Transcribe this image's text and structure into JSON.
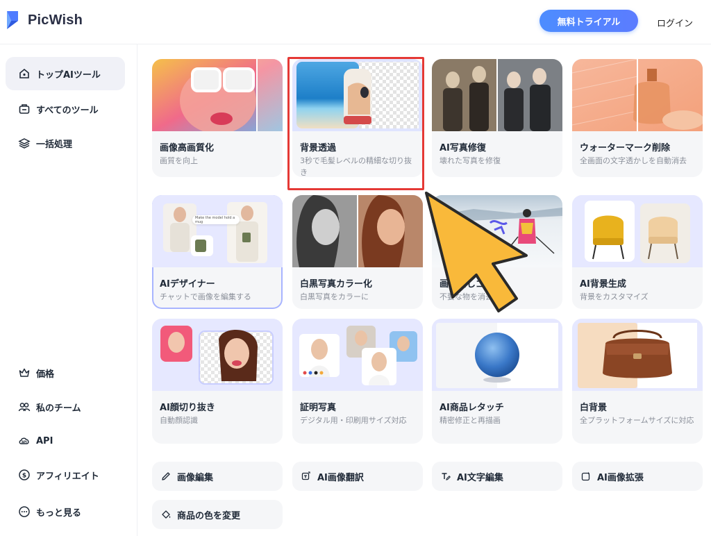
{
  "header": {
    "brand": "PicWish",
    "trial_label": "無料トライアル",
    "login_label": "ログイン"
  },
  "sidebar": {
    "top_items": [
      {
        "label": "トップAIツール",
        "icon": "home-icon"
      },
      {
        "label": "すべてのツール",
        "icon": "toolbox-icon"
      },
      {
        "label": "一括処理",
        "icon": "layers-icon"
      }
    ],
    "bottom_items": [
      {
        "label": "価格",
        "icon": "crown-icon"
      },
      {
        "label": "私のチーム",
        "icon": "team-icon"
      },
      {
        "label": "API",
        "icon": "api-icon"
      },
      {
        "label": "アフィリエイト",
        "icon": "dollar-icon"
      },
      {
        "label": "もっと見る",
        "icon": "more-icon"
      }
    ]
  },
  "tools": [
    {
      "title": "画像高画質化",
      "desc": "画質を向上"
    },
    {
      "title": "背景透過",
      "desc": "3秒で毛髪レベルの精細な切り抜き"
    },
    {
      "title": "AI写真修復",
      "desc": "壊れた写真を修復"
    },
    {
      "title": "ウォーターマーク削除",
      "desc": "全画面の文字透かしを自動消去"
    },
    {
      "title": "AIデザイナー",
      "desc": "チャットで画像を編集する"
    },
    {
      "title": "白黒写真カラー化",
      "desc": "白黒写真をカラーに"
    },
    {
      "title": "画像消しゴム",
      "desc": "不要な物を消去"
    },
    {
      "title": "AI背景生成",
      "desc": "背景をカスタマイズ"
    },
    {
      "title": "AI顔切り抜き",
      "desc": "自動顔認識"
    },
    {
      "title": "証明写真",
      "desc": "デジタル用・印刷用サイズ対応"
    },
    {
      "title": "AI商品レタッチ",
      "desc": "精密修正と再描画"
    },
    {
      "title": "白背景",
      "desc": "全プラットフォームサイズに対応"
    }
  ],
  "chips": [
    {
      "label": "画像編集",
      "icon": "pencil-icon"
    },
    {
      "label": "AI画像翻訳",
      "icon": "translate-icon"
    },
    {
      "label": "AI文字編集",
      "icon": "text-edit-icon"
    },
    {
      "label": "AI画像拡張",
      "icon": "expand-icon"
    },
    {
      "label": "商品の色を変更",
      "icon": "paint-bucket-icon"
    }
  ],
  "designer_prompt": "Make the model hold a mug",
  "colors": {
    "accent": "#4d8dff",
    "highlight_box": "#e53935",
    "arrow": "#f9b93a",
    "card_bg": "#f5f6f8"
  }
}
